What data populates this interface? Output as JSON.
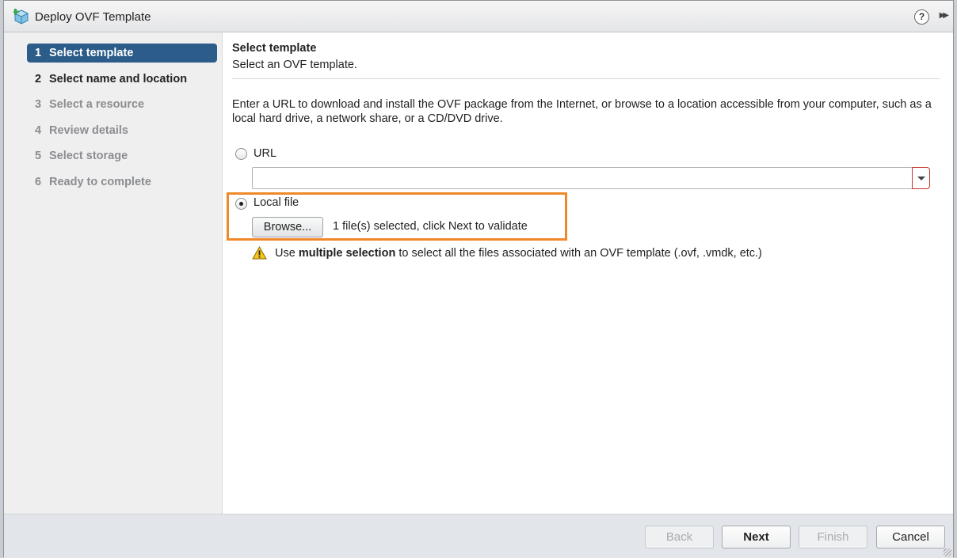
{
  "window": {
    "title": "Deploy OVF Template",
    "help_glyph": "?",
    "expand_glyph": "▶▶"
  },
  "sidebar": {
    "steps": [
      {
        "num": "1",
        "label": "Select template",
        "state": "active"
      },
      {
        "num": "2",
        "label": "Select name and location",
        "state": "enabled"
      },
      {
        "num": "3",
        "label": "Select a resource",
        "state": "disabled"
      },
      {
        "num": "4",
        "label": "Review details",
        "state": "disabled"
      },
      {
        "num": "5",
        "label": "Select storage",
        "state": "disabled"
      },
      {
        "num": "6",
        "label": "Ready to complete",
        "state": "disabled"
      }
    ]
  },
  "content": {
    "title": "Select template",
    "subtitle": "Select an OVF template.",
    "description": "Enter a URL to download and install the OVF package from the Internet, or browse to a location accessible from your computer, such as a local hard drive, a network share, or a CD/DVD drive.",
    "url_option": {
      "label": "URL",
      "selected": false,
      "value": ""
    },
    "local_option": {
      "label": "Local file",
      "selected": true
    },
    "browse_label": "Browse...",
    "selected_text": "1 file(s) selected, click Next to validate",
    "warning": {
      "prefix": "Use ",
      "bold": "multiple selection",
      "suffix": " to select all the files associated with an OVF template (.ovf, .vmdk, etc.)"
    }
  },
  "footer": {
    "back": "Back",
    "next": "Next",
    "finish": "Finish",
    "cancel": "Cancel"
  },
  "colors": {
    "active_step": "#2b5c8a",
    "highlight": "#f0882a",
    "warning": "#f5c518"
  }
}
